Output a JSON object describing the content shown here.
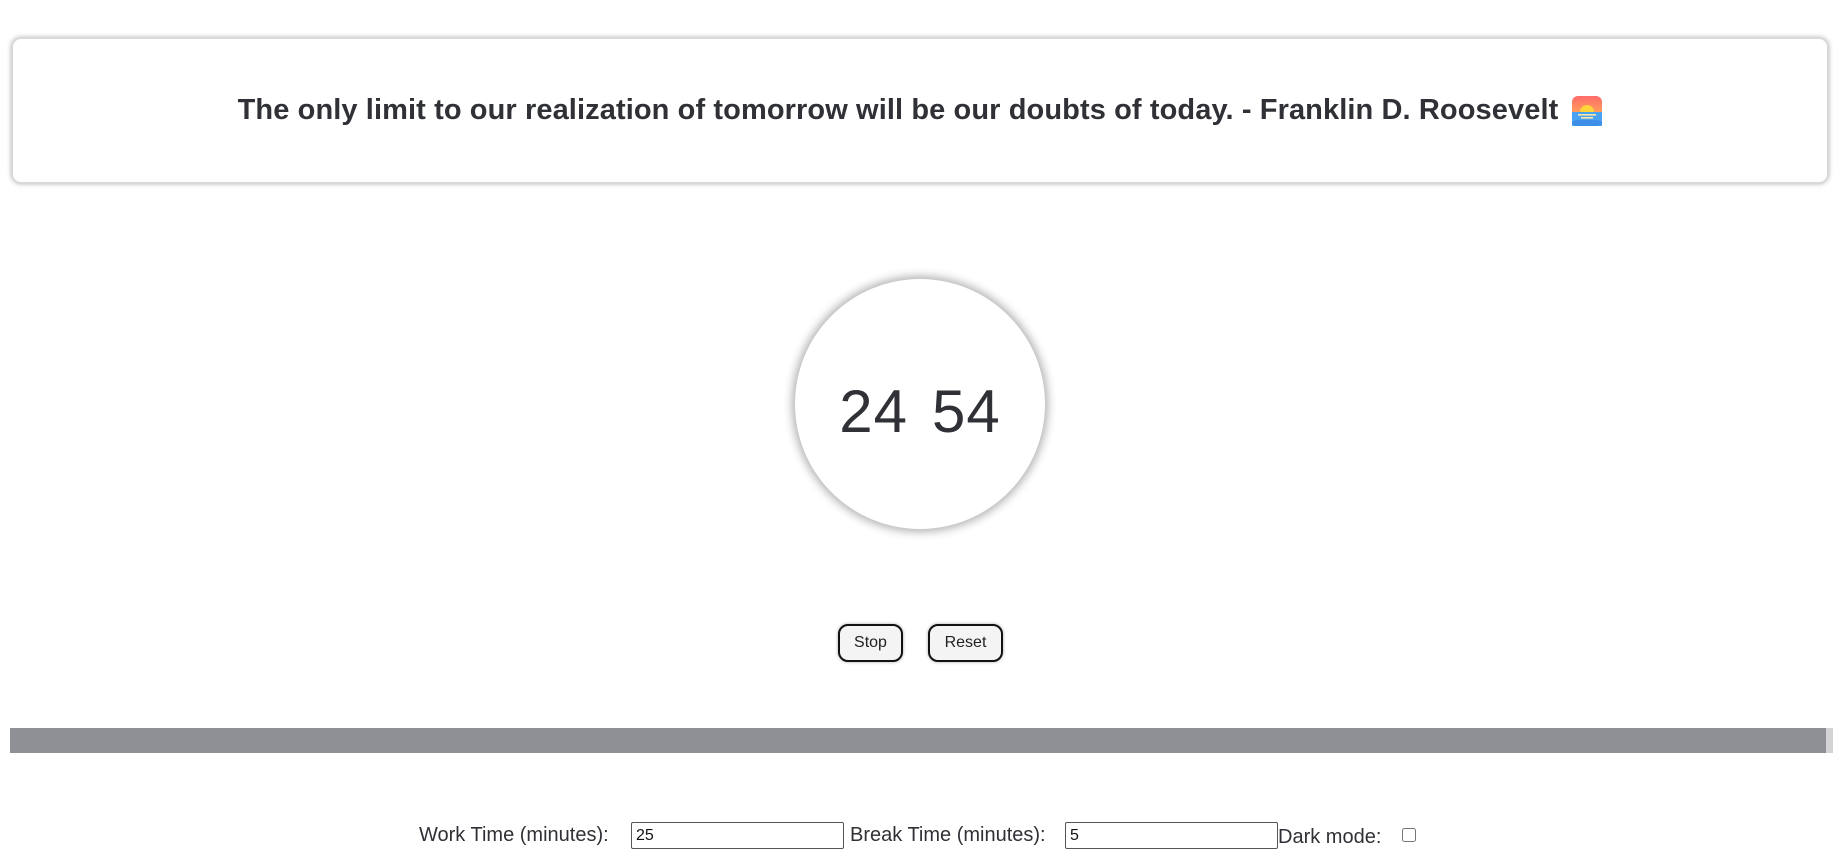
{
  "quote": {
    "text": "The only limit to our realization of tomorrow will be our doubts of today. - Franklin D. Roosevelt",
    "icon": "sunrise-icon"
  },
  "timer": {
    "minutes": "24",
    "seconds": "54"
  },
  "controls": {
    "stop_label": "Stop",
    "reset_label": "Reset"
  },
  "progress": {
    "fraction": 0.996,
    "fill_color": "#8e9095",
    "track_color": "#d3d3d3"
  },
  "settings": {
    "work_label": "Work Time (minutes):",
    "work_value": "25",
    "break_label": "Break Time (minutes):",
    "break_value": "5",
    "dark_mode_label": "Dark mode:",
    "dark_mode_checked": false
  }
}
